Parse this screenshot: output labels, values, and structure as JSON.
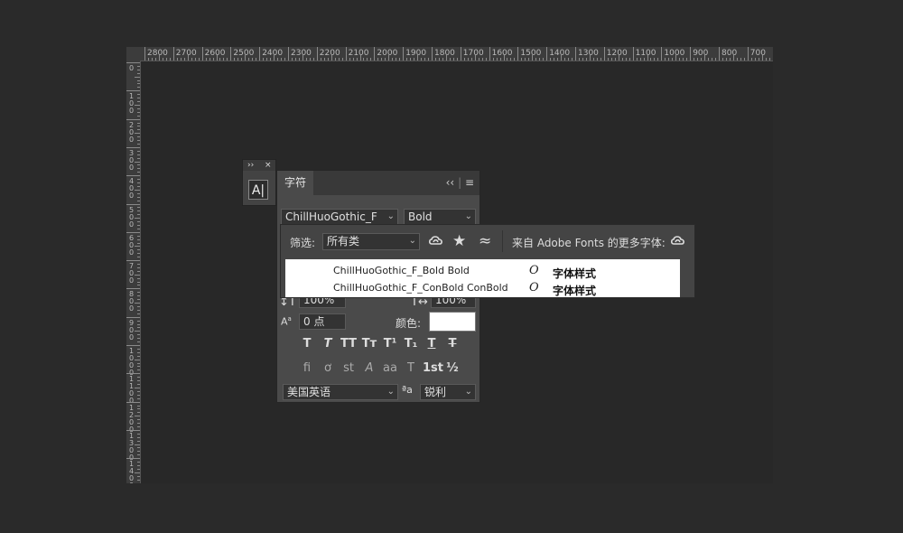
{
  "ruler": {
    "top_labels": [
      "2800",
      "2700",
      "2600",
      "2500",
      "2400",
      "2300",
      "2200",
      "2100",
      "2000",
      "1900",
      "1800",
      "1700",
      "1600",
      "1500",
      "1400",
      "1300",
      "1200",
      "1100",
      "1000",
      "900",
      "800",
      "700"
    ],
    "left_labels": [
      "0",
      "100",
      "200",
      "300",
      "400",
      "500",
      "600",
      "700",
      "800",
      "900",
      "1000",
      "1100",
      "1200",
      "1300",
      "1400",
      "1500"
    ]
  },
  "mini_panel": {
    "expand_glyph": "››",
    "close_glyph": "×",
    "tool_glyph": "A|"
  },
  "character_panel": {
    "tab_label": "字符",
    "collapse_glyph": "‹‹",
    "menu_glyph": "≡",
    "font_family": "ChillHuoGothic_F",
    "font_style": "Bold",
    "vertical_scale": "100%",
    "horizontal_scale": "100%",
    "baseline_shift": "0 点",
    "color_label": "颜色:",
    "style_buttons_row1": [
      "T",
      "T",
      "TT",
      "Tт",
      "T¹",
      "T₁",
      "T",
      "T"
    ],
    "style_buttons_row2": [
      "fi",
      "ơ",
      "st",
      "A",
      "aa",
      "T",
      "1st",
      "½"
    ],
    "language": "美国英语",
    "aa_icon": "ªa",
    "antialias": "锐利"
  },
  "filter_popup": {
    "filter_label": "筛选:",
    "filter_value": "所有类",
    "adobe_fonts_text": "来自 Adobe Fonts 的更多字体:",
    "results": [
      {
        "name": "ChillHuoGothic_F_Bold Bold",
        "type_glyph": "O",
        "sample": "字体样式"
      },
      {
        "name": "ChillHuoGothic_F_ConBold ConBold",
        "type_glyph": "O",
        "sample": "字体样式"
      }
    ]
  },
  "colors": {
    "app_bg": "#262626",
    "panel_bg": "#4a4a4a",
    "list_bg": "#ffffff"
  }
}
